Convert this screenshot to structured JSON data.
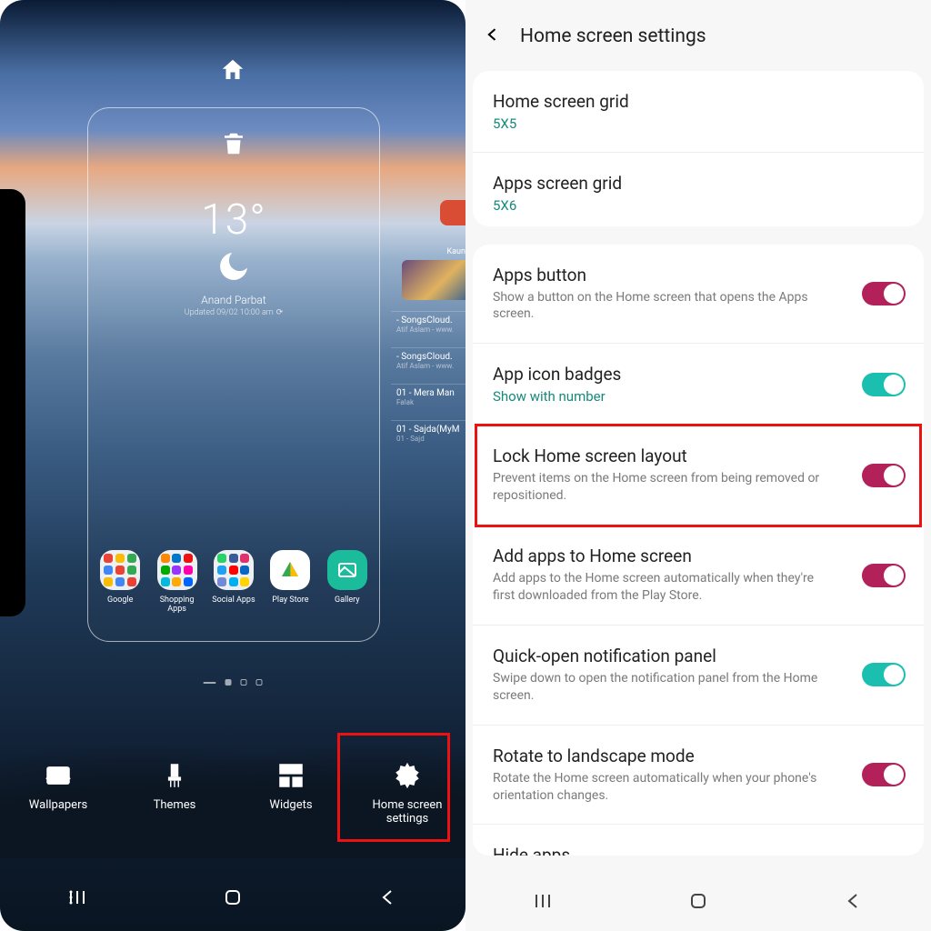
{
  "left": {
    "weather": {
      "temp": "13°",
      "location": "Anand Parbat",
      "updated": "Updated 09/02 10:00 am"
    },
    "apps": [
      {
        "label": "Google",
        "type": "folder",
        "colors": [
          "#ea4335",
          "#fbbc05",
          "#34a853",
          "#4285f4",
          "#ea4335",
          "#34a853",
          "#fbbc05",
          "#4285f4",
          "#ea4335"
        ]
      },
      {
        "label": "Shopping Apps",
        "type": "folder",
        "colors": [
          "#f80",
          "#07c",
          "#e11",
          "#0a0",
          "#93f",
          "#f0a",
          "#0bd",
          "#fa0",
          "#06f"
        ]
      },
      {
        "label": "Social Apps",
        "type": "folder",
        "colors": [
          "#25d366",
          "#3b5998",
          "#e1306c",
          "#1da1f2",
          "#ff0000",
          "#0a66c2",
          "#7289da",
          "#00aff0",
          "#ffd400"
        ]
      },
      {
        "label": "Play Store",
        "type": "play"
      },
      {
        "label": "Gallery",
        "type": "gallery"
      }
    ],
    "peek": {
      "k": "Kaun",
      "tracks": [
        {
          "name": "- SongsCloud.",
          "artist": "Atif Aslam - www."
        },
        {
          "name": "- SongsCloud.",
          "artist": "Atif Aslam - www."
        },
        {
          "name": "01 - Mera Man",
          "artist": "Falak"
        },
        {
          "name": "01 - Sajda(MyM",
          "artist": "01 - Sajd"
        }
      ]
    },
    "editRow": [
      {
        "label": "Wallpapers",
        "icon": "wallpaper"
      },
      {
        "label": "Themes",
        "icon": "brush"
      },
      {
        "label": "Widgets",
        "icon": "widgets"
      },
      {
        "label": "Home screen settings",
        "icon": "gear"
      }
    ]
  },
  "right": {
    "title": "Home screen settings",
    "group1": [
      {
        "title": "Home screen grid",
        "link": "5X5"
      },
      {
        "title": "Apps screen grid",
        "link": "5X6"
      }
    ],
    "group2": [
      {
        "title": "Apps button",
        "desc": "Show a button on the Home screen that opens the Apps screen.",
        "toggle": "on-pink"
      },
      {
        "title": "App icon badges",
        "link": "Show with number",
        "toggle": "on-teal"
      },
      {
        "title": "Lock Home screen layout",
        "desc": "Prevent items on the Home screen from being removed or repositioned.",
        "toggle": "on-pink",
        "highlight": true
      },
      {
        "title": "Add apps to Home screen",
        "desc": "Add apps to the Home screen automatically when they're first downloaded from the Play Store.",
        "toggle": "on-pink"
      },
      {
        "title": "Quick-open notification panel",
        "desc": "Swipe down to open the notification panel from the Home screen.",
        "toggle": "on-teal"
      },
      {
        "title": "Rotate to landscape mode",
        "desc": "Rotate the Home screen automatically when your phone's orientation changes.",
        "toggle": "on-pink"
      },
      {
        "title": "Hide apps"
      }
    ]
  }
}
